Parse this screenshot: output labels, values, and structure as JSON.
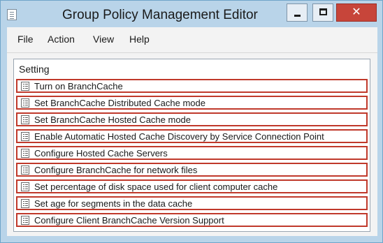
{
  "window": {
    "title": "Group Policy Management Editor",
    "buttons": {
      "minimize": "minimize",
      "maximize": "maximize",
      "close_glyph": "✕"
    }
  },
  "menu": {
    "items": [
      "File",
      "Action",
      "View",
      "Help"
    ]
  },
  "list": {
    "column_header": "Setting",
    "rows": [
      "Turn on BranchCache",
      "Set BranchCache Distributed Cache mode",
      "Set BranchCache Hosted Cache mode",
      "Enable Automatic Hosted Cache Discovery by Service Connection Point",
      "Configure Hosted Cache Servers",
      "Configure BranchCache for network files",
      "Set percentage of disk space used for client computer cache",
      "Set age for segments in the data cache",
      "Configure Client BranchCache Version Support"
    ],
    "row_icon": "policy-setting-icon",
    "highlight_color": "#c0392b"
  },
  "colors": {
    "chrome": "#b9d4e9",
    "close_button": "#c7453a"
  }
}
